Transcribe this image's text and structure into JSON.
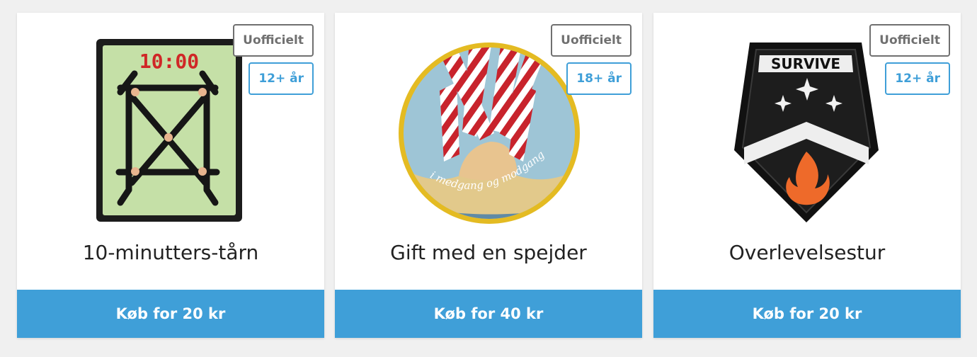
{
  "theme": {
    "accent": "#3f9fd8",
    "official_badge_color": "#707070",
    "age_badge_color": "#3f9fd8",
    "background": "#f0f0f0",
    "card_background": "#ffffff"
  },
  "products": [
    {
      "title": "10-minutters-tårn",
      "official_badge": "Uofficielt",
      "age_badge": "12+ år",
      "buy_label": "Køb for 20 kr",
      "image": {
        "icon": "tower-patch-icon",
        "text": "10:00"
      }
    },
    {
      "title": "Gift med en spejder",
      "official_badge": "Uofficielt",
      "age_badge": "18+ år",
      "buy_label": "Køb for 40 kr",
      "image": {
        "icon": "scarf-handshake-patch-icon",
        "text": "i medgang og modgang"
      }
    },
    {
      "title": "Overlevelsestur",
      "official_badge": "Uofficielt",
      "age_badge": "12+ år",
      "buy_label": "Køb for 20 kr",
      "image": {
        "icon": "survive-shield-patch-icon",
        "text": "SURVIVE"
      }
    }
  ]
}
